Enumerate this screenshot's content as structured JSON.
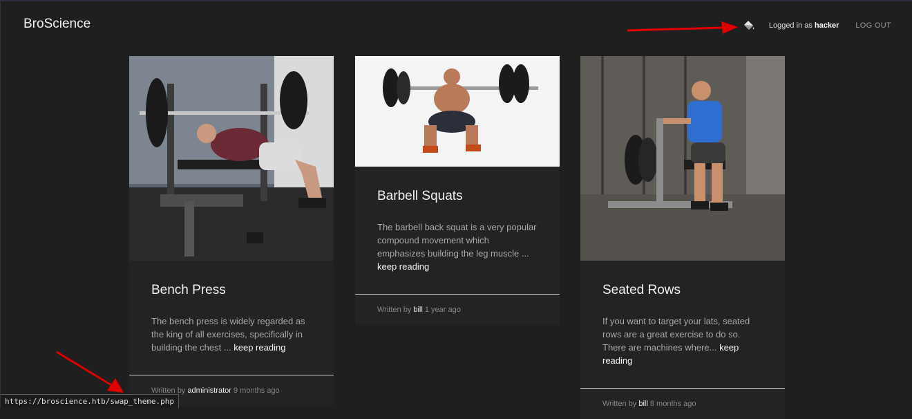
{
  "navbar": {
    "brand": "BroScience",
    "theme_icon": "paint-bucket-icon",
    "logged_in_prefix": "Logged in as ",
    "username": "hacker",
    "logout_label": "LOG OUT"
  },
  "posts": [
    {
      "title": "Bench Press",
      "excerpt": "The bench press is widely regarded as the king of all exercises, specifically in building the chest ... ",
      "keep_reading": "keep reading",
      "written_by": "Written by ",
      "author": "administrator",
      "age": " 9 months ago",
      "image": "bench-press-photo"
    },
    {
      "title": "Barbell Squats",
      "excerpt": "The barbell back squat is a very popular compound movement which emphasizes building the leg muscle ... ",
      "keep_reading": "keep reading",
      "written_by": "Written by ",
      "author": "bill",
      "age": " 1 year ago",
      "image": "barbell-squat-photo"
    },
    {
      "title": "Seated Rows",
      "excerpt": "If you want to target your lats, seated rows are a great exercise to do so. There are machines where... ",
      "keep_reading": "keep reading",
      "written_by": "Written by ",
      "author": "bill",
      "age": " 8 months ago",
      "image": "seated-rows-photo"
    }
  ],
  "status_bar": {
    "url": "https://broscience.htb/swap_theme.php"
  },
  "colors": {
    "background": "#1f1f1f",
    "card": "#232323",
    "annotation_arrow": "#e00000"
  }
}
